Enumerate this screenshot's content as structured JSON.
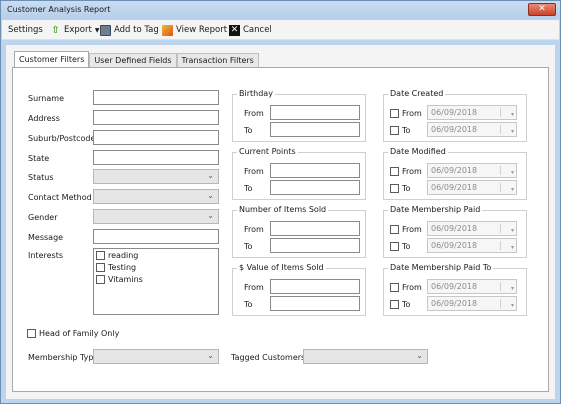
{
  "window": {
    "title": "Customer Analysis Report",
    "close_glyph": "✕"
  },
  "menubar": {
    "settings": "Settings",
    "export": "Export",
    "add_to_tag": "Add to Tag",
    "view_report": "View Report",
    "cancel": "Cancel"
  },
  "tabs": [
    "Customer Filters",
    "User Defined Fields",
    "Transaction Filters"
  ],
  "customer": {
    "surname": "Surname",
    "address": "Address",
    "suburb": "Suburb/Postcode",
    "state": "State",
    "status": "Status",
    "contact_method": "Contact Method",
    "gender": "Gender",
    "message": "Message",
    "interests": "Interests",
    "interest_items": [
      "reading",
      "Testing",
      "Vitamins"
    ],
    "head_of_family": "Head of Family Only",
    "membership_type": "Membership Type",
    "tagged_customers": "Tagged Customers"
  },
  "ranges": {
    "from": "From",
    "to": "To",
    "birthday": "Birthday",
    "current_points": "Current Points",
    "items_sold": "Number of Items Sold",
    "value_sold": "$ Value of Items Sold"
  },
  "dates": {
    "date_created": "Date Created",
    "date_modified": "Date Modified",
    "membership_paid": "Date Membership Paid",
    "membership_paid_to": "Date Membership Paid To",
    "value": "06/09/2018"
  },
  "icons": {
    "export": "export-icon",
    "add_to_tag": "tag-icon",
    "view_report": "report-icon",
    "cancel": "cancel-icon",
    "dropdown": "chevron-down-icon"
  }
}
